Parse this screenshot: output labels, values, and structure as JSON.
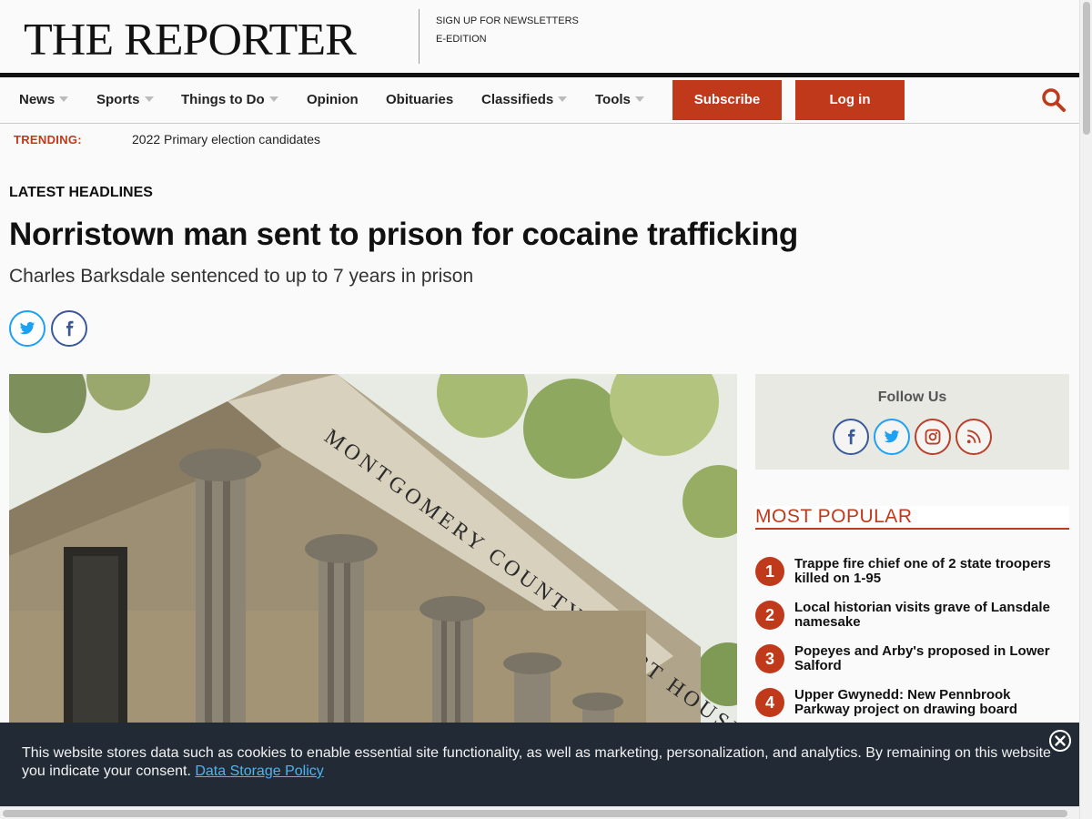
{
  "masthead": {
    "logo": "THE REPORTER",
    "links": [
      "SIGN UP FOR NEWSLETTERS",
      "E-EDITION"
    ]
  },
  "nav": {
    "items": [
      {
        "label": "News",
        "dropdown": true
      },
      {
        "label": "Sports",
        "dropdown": true
      },
      {
        "label": "Things to Do",
        "dropdown": true
      },
      {
        "label": "Opinion",
        "dropdown": false
      },
      {
        "label": "Obituaries",
        "dropdown": false
      },
      {
        "label": "Classifieds",
        "dropdown": true
      },
      {
        "label": "Tools",
        "dropdown": true
      }
    ],
    "subscribe_label": "Subscribe",
    "login_label": "Log in",
    "search_icon": "search-icon"
  },
  "trending": {
    "label": "TRENDING:",
    "link": "2022 Primary election candidates"
  },
  "article": {
    "section": "LATEST HEADLINES",
    "headline": "Norristown man sent to prison for cocaine trafficking",
    "subhead": "Charles Barksdale sentenced to up to 7 years in prison",
    "share_icons": [
      "twitter-icon",
      "facebook-icon"
    ],
    "image_text": "MONTGOMERY COUNTY COURT HOUSE"
  },
  "sidebar": {
    "follow_title": "Follow Us",
    "social_icons": [
      "facebook-icon",
      "twitter-icon",
      "instagram-icon",
      "rss-icon"
    ],
    "most_popular_title": "MOST POPULAR",
    "popular": [
      {
        "num": "1",
        "title": "Trappe fire chief one of 2 state troopers killed on 1-95"
      },
      {
        "num": "2",
        "title": "Local historian visits grave of Lansdale namesake"
      },
      {
        "num": "3",
        "title": "Popeyes and Arby's proposed in Lower Salford"
      },
      {
        "num": "4",
        "title": "Upper Gwynedd: New Pennbrook Parkway project on drawing board"
      }
    ]
  },
  "cookie": {
    "text": "This website stores data such as cookies to enable essential site functionality, as well as marketing, personalization, and analytics. By remaining on this website you indicate your consent.",
    "link": "Data Storage Policy"
  },
  "colors": {
    "brand_red": "#c0391b",
    "banner_bg": "#222b35",
    "link_blue": "#4fb3f0"
  }
}
